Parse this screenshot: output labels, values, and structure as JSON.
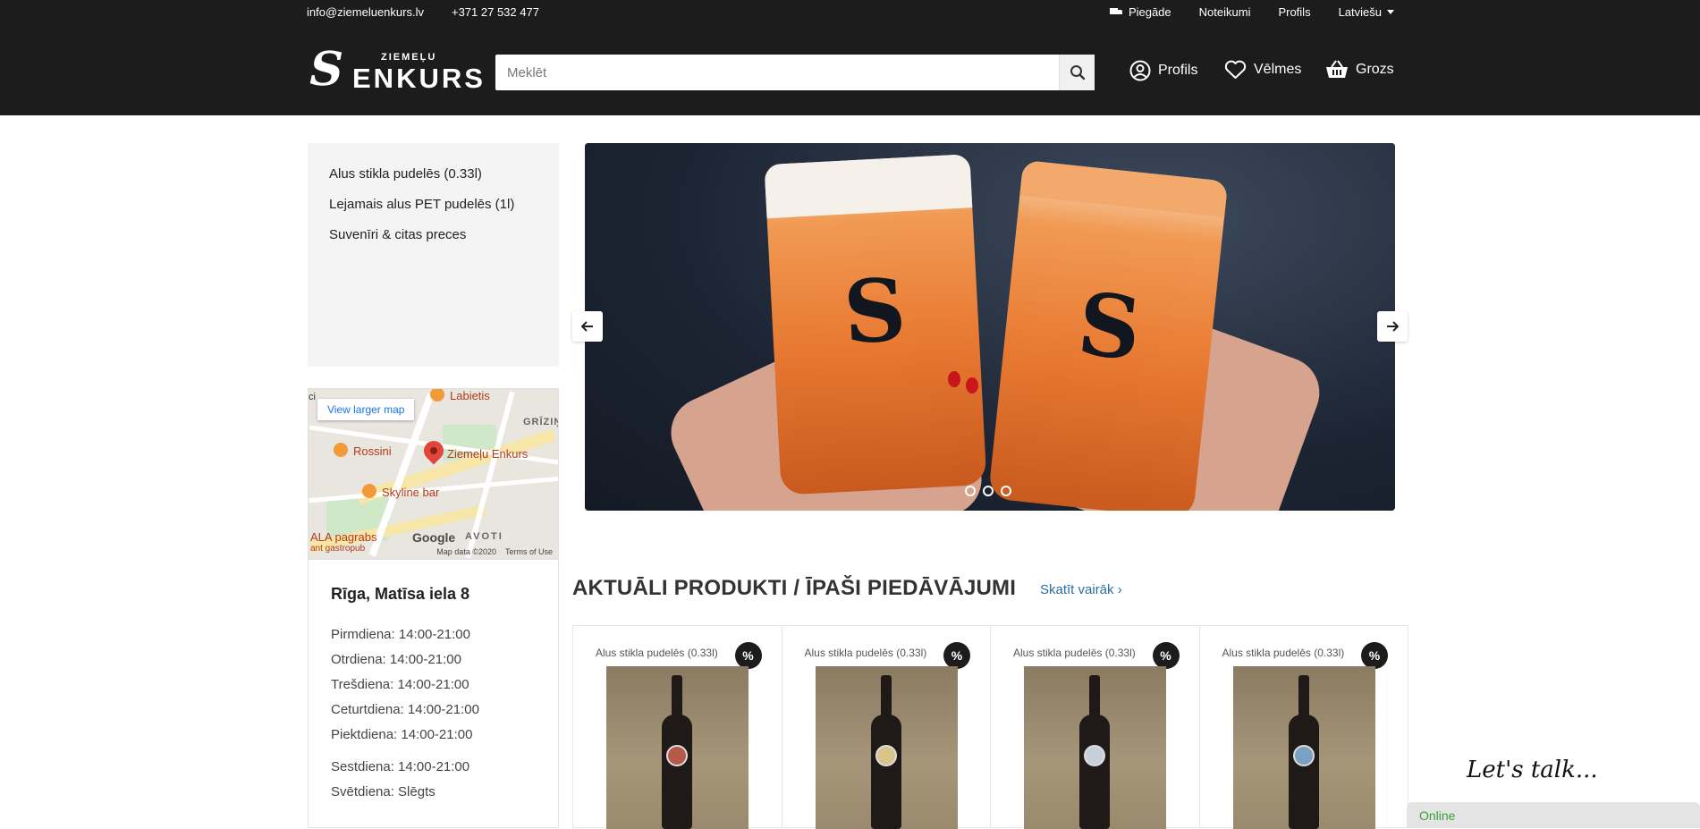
{
  "topbar": {
    "email": "info@ziemeluenkurs.lv",
    "phone": "+371 27 532 477",
    "delivery": "Piegāde",
    "terms": "Noteikumi",
    "profile": "Profils",
    "language": "Latviešu"
  },
  "logo": {
    "small": "ZIEMEĻU",
    "big": "ENKURS"
  },
  "search": {
    "placeholder": "Meklēt"
  },
  "header": {
    "profile": "Profils",
    "wishlist": "Vēlmes",
    "cart": "Grozs"
  },
  "categories": [
    "Alus stikla pudelēs (0.33l)",
    "Lejamais alus PET pudelēs (1l)",
    "Suvenīri & citas preces"
  ],
  "map": {
    "button": "View larger map",
    "labels": {
      "labietis": "Labietis",
      "grizinka": "GRĪZIŅKA",
      "rossini": "Rossini",
      "enkurs": "Ziemeļu Enkurs",
      "skyline": "Skyline bar",
      "ala": "ALA pagrabs",
      "ala_sub": "ant gastropub",
      "avoti": "AVOTI",
      "ci": "ci"
    },
    "google": "Google",
    "map_data": "Map data ©2020",
    "terms": "Terms of Use"
  },
  "address": {
    "title": "Rīga, Matīsa iela 8",
    "hours": [
      "Pirmdiena: 14:00-21:00",
      "Otrdiena: 14:00-21:00",
      "Trešdiena: 14:00-21:00",
      "Ceturtdiena: 14:00-21:00",
      "Piektdiena: 14:00-21:00"
    ],
    "weekend": [
      "Sestdiena: 14:00-21:00",
      "Svētdiena: Slēgts"
    ]
  },
  "section": {
    "title": "AKTUĀLI PRODUKTI / ĪPAŠI PIEDĀVĀJUMI",
    "see_more": "Skatīt vairāk ›"
  },
  "products": [
    {
      "category": "Alus stikla pudelēs (0.33l)",
      "badge": "%"
    },
    {
      "category": "Alus stikla pudelēs (0.33l)",
      "badge": "%"
    },
    {
      "category": "Alus stikla pudelēs (0.33l)",
      "badge": "%"
    },
    {
      "category": "Alus stikla pudelēs (0.33l)",
      "badge": "%"
    }
  ],
  "chat": {
    "title": "Let's talk...",
    "status": "Online"
  },
  "colors": {
    "header_bg": "#1c1c1c",
    "sidebar_bg": "#f4f4f4",
    "link": "#2a6fa1",
    "chat_online": "#3aa13a"
  }
}
